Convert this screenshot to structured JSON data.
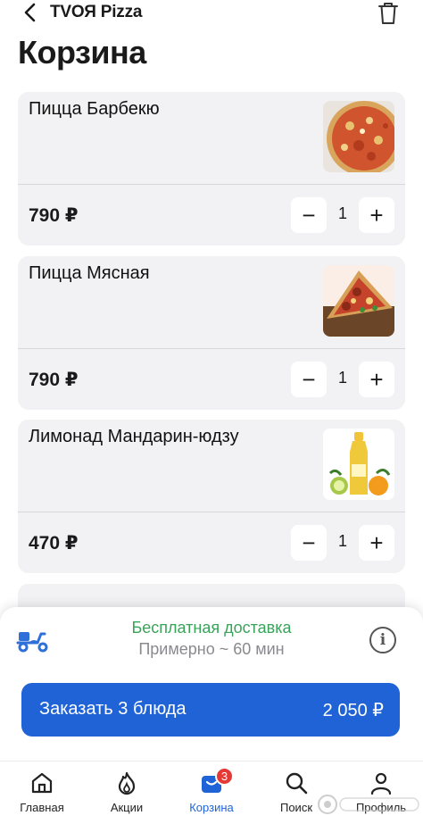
{
  "header": {
    "app_title": "TVОЯ Pizza",
    "page_title": "Корзина",
    "back_icon": "chevron-left-icon",
    "trash_icon": "trash-icon"
  },
  "cart": {
    "items": [
      {
        "name": "Пицца Барбекю",
        "price": "790 ₽",
        "qty": "1",
        "image": "bbq-pizza"
      },
      {
        "name": "Пицца Мясная",
        "price": "790 ₽",
        "qty": "1",
        "image": "meat-pizza"
      },
      {
        "name": "Лимонад Мандарин-юдзу",
        "price": "470 ₽",
        "qty": "1",
        "image": "lemonade-bottle"
      }
    ],
    "minus_label": "−",
    "plus_label": "+"
  },
  "delivery": {
    "title": "Бесплатная доставка",
    "subtitle": "Примерно ~ 60 мин",
    "icon": "scooter-icon",
    "info_icon": "info-icon",
    "info_glyph": "i"
  },
  "order": {
    "label": "Заказать 3 блюда",
    "total": "2 050 ₽"
  },
  "tabbar": {
    "tabs": [
      {
        "label": "Главная",
        "icon": "home-icon",
        "active": false
      },
      {
        "label": "Акции",
        "icon": "flame-icon",
        "active": false
      },
      {
        "label": "Корзина",
        "icon": "bag-icon",
        "active": true,
        "badge": "3"
      },
      {
        "label": "Поиск",
        "icon": "search-icon",
        "active": false
      },
      {
        "label": "Профиль",
        "icon": "profile-icon",
        "active": false
      }
    ]
  },
  "colors": {
    "accent": "#1f63d6",
    "delivery_green": "#3aa35a",
    "badge_red": "#e53935",
    "card_bg": "#f2f2f4"
  }
}
